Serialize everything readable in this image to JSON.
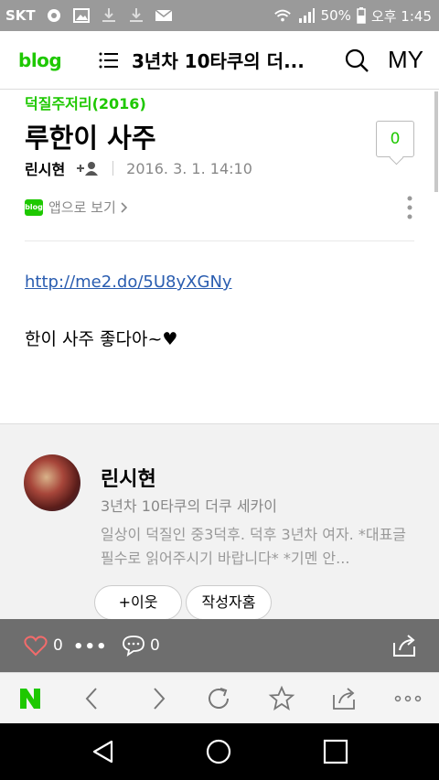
{
  "status_bar": {
    "carrier": "SKT",
    "battery": "50%",
    "time": "오후 1:45"
  },
  "app_bar": {
    "logo": "blog",
    "blog_title": "3년차 10타쿠의 더...",
    "my_label": "MY"
  },
  "post": {
    "category": "덕질주저리(2016)",
    "title": "루한이 사주",
    "author": "린시현",
    "date": "2016. 3. 1. 14:10",
    "comment_count": "0",
    "app_badge": "blog",
    "app_view_label": "앱으로 보기",
    "link": "http://me2.do/5U8yXGNy",
    "body": "한이 사주 좋다아~♥"
  },
  "profile": {
    "name": "린시현",
    "blog_name": "3년차 10타쿠의 더쿠 세카이",
    "description": "일상이 덕질인 중3덕후. 덕후 3년차 여자. *대표글 필수로 읽어주시기 바랍니다* *기멘 안...",
    "follow_label": "+이웃",
    "home_label": "작성자홈"
  },
  "action_bar": {
    "like_count": "0",
    "more_label": "•••",
    "comment_count": "0"
  },
  "icons": {
    "accent_color": "#1ec800"
  }
}
